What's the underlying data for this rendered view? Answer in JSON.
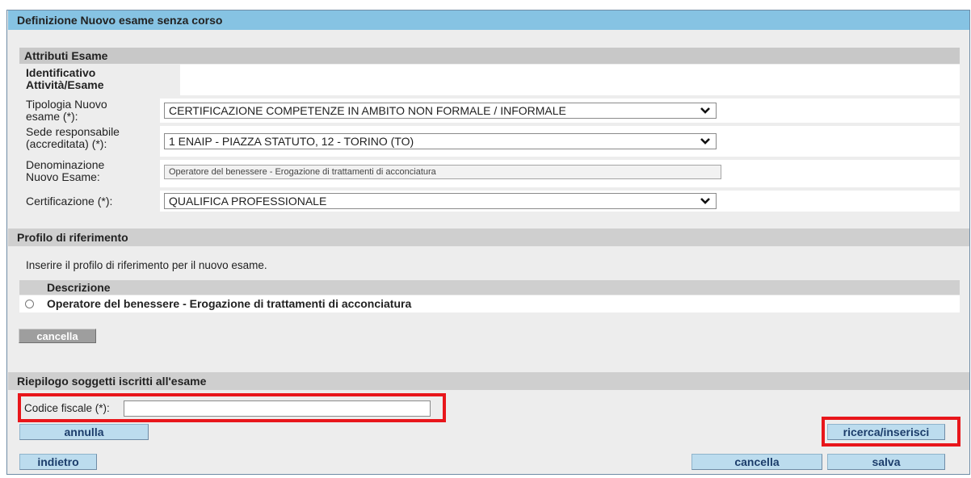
{
  "page": {
    "title": "Definizione Nuovo esame senza corso"
  },
  "attributes": {
    "section_title": "Attributi Esame",
    "identificativo": {
      "label_line1": "Identificativo",
      "label_line2": "Attività/Esame",
      "value": ""
    },
    "tipologia": {
      "label_line1": "Tipologia Nuovo",
      "label_line2": "esame (*):",
      "value": "CERTIFICAZIONE COMPETENZE IN AMBITO NON FORMALE / INFORMALE"
    },
    "sede": {
      "label_line1": "Sede responsabile",
      "label_line2": "(accreditata) (*):",
      "value": "1 ENAIP - PIAZZA STATUTO, 12 - TORINO (TO)"
    },
    "denominazione": {
      "label_line1": "Denominazione",
      "label_line2": "Nuovo Esame:",
      "value": "Operatore del benessere - Erogazione di trattamenti di acconciatura"
    },
    "certificazione": {
      "label": "Certificazione (*):",
      "value": "QUALIFICA PROFESSIONALE"
    }
  },
  "profilo": {
    "section_title": "Profilo di riferimento",
    "instruction": "Inserire il profilo di riferimento per il nuovo esame.",
    "column_header": "Descrizione",
    "rows": [
      {
        "label": "Operatore del benessere - Erogazione di trattamenti di acconciatura",
        "selected": false
      }
    ],
    "cancel_label": "cancella"
  },
  "riepilogo": {
    "section_title": "Riepilogo soggetti iscritti all'esame",
    "codice_fiscale_label": "Codice fiscale (*):",
    "codice_fiscale_value": "",
    "annulla_label": "annulla",
    "ricerca_label": "ricerca/inserisci"
  },
  "footer": {
    "indietro_label": "indietro",
    "cancella_label": "cancella",
    "salva_label": "salva"
  },
  "colors": {
    "title_bar": "#86c3e3",
    "section_bar": "#cfcfcf",
    "button_blue": "#bcdcee",
    "button_gray": "#9e9e9e",
    "highlight_red": "#e8161b"
  }
}
